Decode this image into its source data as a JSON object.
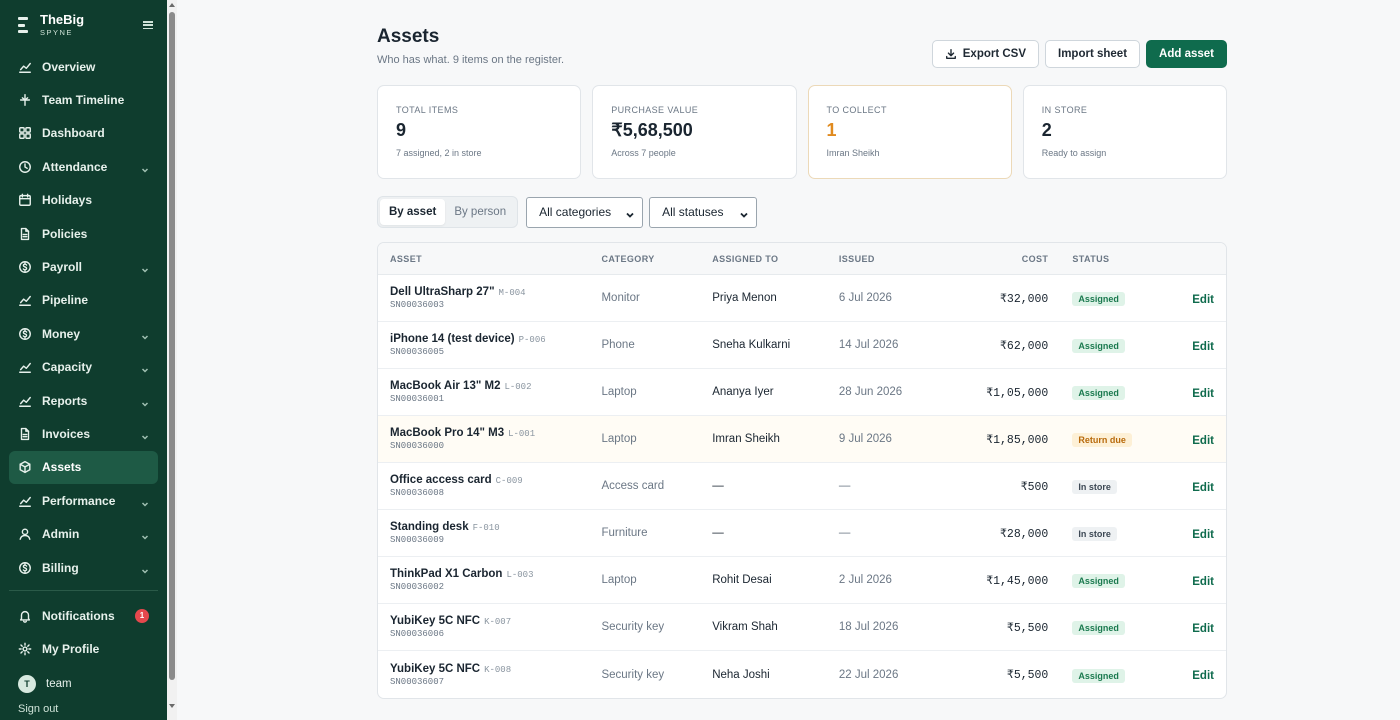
{
  "brand": {
    "name": "TheBig",
    "sub": "SPYNE"
  },
  "sidebar": {
    "items": [
      {
        "label": "Overview",
        "icon": "trend-icon",
        "has_chevron": false
      },
      {
        "label": "Team Timeline",
        "icon": "timeline-icon",
        "has_chevron": false
      },
      {
        "label": "Dashboard",
        "icon": "grid-icon",
        "has_chevron": false
      },
      {
        "label": "Attendance",
        "icon": "clock-icon",
        "has_chevron": true
      },
      {
        "label": "Holidays",
        "icon": "calendar-icon",
        "has_chevron": false
      },
      {
        "label": "Policies",
        "icon": "document-icon",
        "has_chevron": false
      },
      {
        "label": "Payroll",
        "icon": "coin-icon",
        "has_chevron": true
      },
      {
        "label": "Pipeline",
        "icon": "trend-icon",
        "has_chevron": false
      },
      {
        "label": "Money",
        "icon": "coin-icon",
        "has_chevron": true
      },
      {
        "label": "Capacity",
        "icon": "trend-icon",
        "has_chevron": true
      },
      {
        "label": "Reports",
        "icon": "trend-icon",
        "has_chevron": true
      },
      {
        "label": "Invoices",
        "icon": "document-icon",
        "has_chevron": true
      },
      {
        "label": "Assets",
        "icon": "box-icon",
        "has_chevron": false,
        "active": true
      },
      {
        "label": "Performance",
        "icon": "trend-icon",
        "has_chevron": true
      },
      {
        "label": "Admin",
        "icon": "user-icon",
        "has_chevron": true
      },
      {
        "label": "Billing",
        "icon": "coin-icon",
        "has_chevron": true
      }
    ],
    "notifications": {
      "label": "Notifications",
      "count": "1"
    },
    "profile": {
      "label": "My Profile"
    },
    "user": {
      "initial": "T",
      "name": "team"
    },
    "signout": "Sign out"
  },
  "header": {
    "title": "Assets",
    "subtitle": "Who has what. 9 items on the register.",
    "export_label": "Export CSV",
    "import_label": "Import sheet",
    "add_label": "Add asset"
  },
  "stats": [
    {
      "label": "TOTAL ITEMS",
      "value": "9",
      "hint": "7 assigned, 2 in store"
    },
    {
      "label": "PURCHASE VALUE",
      "value": "₹5,68,500",
      "hint": "Across 7 people"
    },
    {
      "label": "TO COLLECT",
      "value": "1",
      "hint": "Imran Sheikh"
    },
    {
      "label": "IN STORE",
      "value": "2",
      "hint": "Ready to assign"
    }
  ],
  "filters": {
    "view_by_asset": "By asset",
    "view_by_person": "By person",
    "category": "All categories",
    "status": "All statuses"
  },
  "table": {
    "headers": {
      "asset": "ASSET",
      "category": "CATEGORY",
      "assigned_to": "ASSIGNED TO",
      "issued": "ISSUED",
      "cost": "COST",
      "status": "STATUS"
    },
    "edit_label": "Edit",
    "rows": [
      {
        "name": "Dell UltraSharp 27\"",
        "code": "M-004",
        "serial": "SN00036003",
        "category": "Monitor",
        "assigned_to": "Priya Menon",
        "issued": "6 Jul 2026",
        "cost": "₹32,000",
        "status": "Assigned"
      },
      {
        "name": "iPhone 14 (test device)",
        "code": "P-006",
        "serial": "SN00036005",
        "category": "Phone",
        "assigned_to": "Sneha Kulkarni",
        "issued": "14 Jul 2026",
        "cost": "₹62,000",
        "status": "Assigned"
      },
      {
        "name": "MacBook Air 13\" M2",
        "code": "L-002",
        "serial": "SN00036001",
        "category": "Laptop",
        "assigned_to": "Ananya Iyer",
        "issued": "28 Jun 2026",
        "cost": "₹1,05,000",
        "status": "Assigned"
      },
      {
        "name": "MacBook Pro 14\" M3",
        "code": "L-001",
        "serial": "SN00036000",
        "category": "Laptop",
        "assigned_to": "Imran Sheikh",
        "issued": "9 Jul 2026",
        "cost": "₹1,85,000",
        "status": "Return due"
      },
      {
        "name": "Office access card",
        "code": "C-009",
        "serial": "SN00036008",
        "category": "Access card",
        "assigned_to": "—",
        "issued": "—",
        "cost": "₹500",
        "status": "In store"
      },
      {
        "name": "Standing desk",
        "code": "F-010",
        "serial": "SN00036009",
        "category": "Furniture",
        "assigned_to": "—",
        "issued": "—",
        "cost": "₹28,000",
        "status": "In store"
      },
      {
        "name": "ThinkPad X1 Carbon",
        "code": "L-003",
        "serial": "SN00036002",
        "category": "Laptop",
        "assigned_to": "Rohit Desai",
        "issued": "2 Jul 2026",
        "cost": "₹1,45,000",
        "status": "Assigned"
      },
      {
        "name": "YubiKey 5C NFC",
        "code": "K-007",
        "serial": "SN00036006",
        "category": "Security key",
        "assigned_to": "Vikram Shah",
        "issued": "18 Jul 2026",
        "cost": "₹5,500",
        "status": "Assigned"
      },
      {
        "name": "YubiKey 5C NFC",
        "code": "K-008",
        "serial": "SN00036007",
        "category": "Security key",
        "assigned_to": "Neha Joshi",
        "issued": "22 Jul 2026",
        "cost": "₹5,500",
        "status": "Assigned"
      }
    ]
  },
  "colors": {
    "sidebar_bg": "#0f3d2e",
    "primary": "#0f6b4d",
    "warning": "#e08a1e",
    "badge": "#e5484d"
  }
}
